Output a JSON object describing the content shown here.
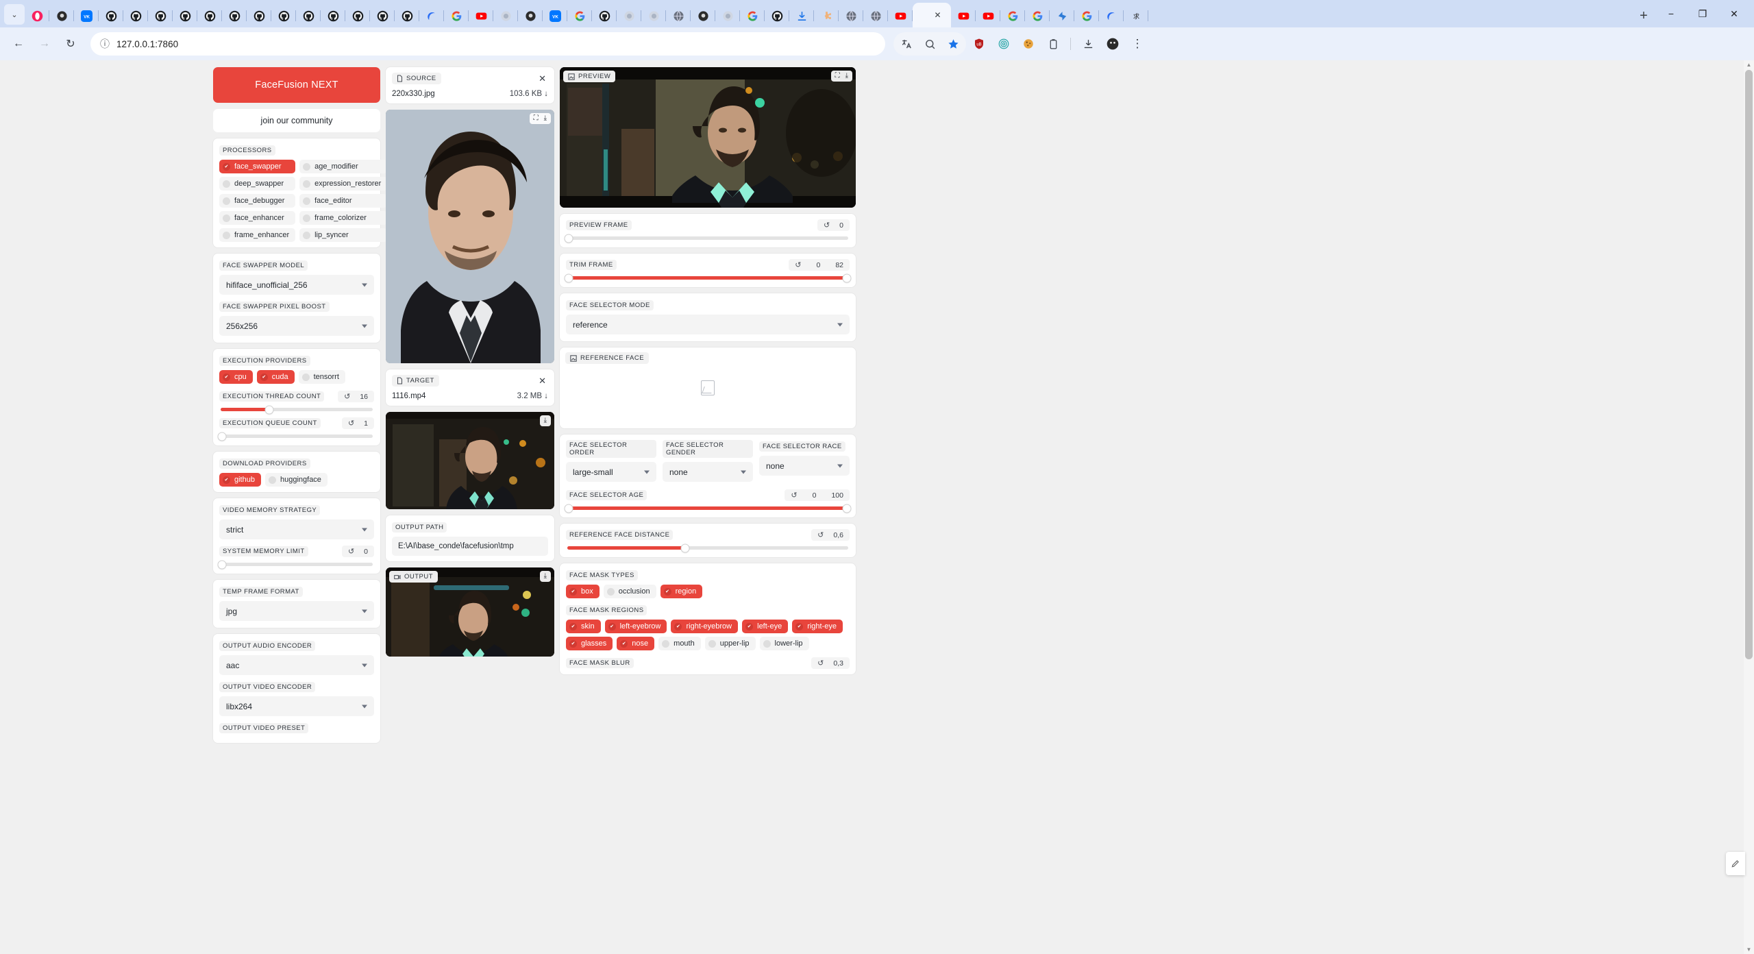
{
  "browser": {
    "url": "127.0.0.1:7860",
    "back_label": "←",
    "forward_label": "→",
    "reload_label": "↻",
    "site_info_label": "ⓘ",
    "new_tab_label": "+",
    "minimize_label": "−",
    "maximize_label": "❐",
    "close_label": "✕",
    "tab_close_label": "✕",
    "menu_label": "⋮",
    "tab_search_label": "⌄",
    "extensions": [
      "translate-icon",
      "zoom-icon",
      "bookmark-star-icon",
      "ublock-icon",
      "fingerprint-icon",
      "cookie-icon",
      "clipboard-icon",
      "download-icon",
      "profile-icon",
      "browser-menu-icon"
    ]
  },
  "app": {
    "brand": "FaceFusion NEXT",
    "community": "join our community",
    "processors": {
      "label": "PROCESSORS",
      "items": [
        {
          "name": "face_swapper",
          "on": true
        },
        {
          "name": "age_modifier",
          "on": false
        },
        {
          "name": "deep_swapper",
          "on": false
        },
        {
          "name": "expression_restorer",
          "on": false
        },
        {
          "name": "face_debugger",
          "on": false
        },
        {
          "name": "face_editor",
          "on": false
        },
        {
          "name": "face_enhancer",
          "on": false
        },
        {
          "name": "frame_colorizer",
          "on": false
        },
        {
          "name": "frame_enhancer",
          "on": false
        },
        {
          "name": "lip_syncer",
          "on": false
        }
      ]
    },
    "face_swapper_model": {
      "label": "FACE SWAPPER MODEL",
      "value": "hififace_unofficial_256"
    },
    "face_swapper_pixel_boost": {
      "label": "FACE SWAPPER PIXEL BOOST",
      "value": "256x256"
    },
    "execution_providers": {
      "label": "EXECUTION PROVIDERS",
      "items": [
        {
          "name": "cpu",
          "on": true
        },
        {
          "name": "cuda",
          "on": true
        },
        {
          "name": "tensorrt",
          "on": false
        }
      ]
    },
    "execution_thread_count": {
      "label": "EXECUTION THREAD COUNT",
      "value": "16",
      "percent": 32,
      "reset": "↺"
    },
    "execution_queue_count": {
      "label": "EXECUTION QUEUE COUNT",
      "value": "1",
      "percent": 0,
      "reset": "↺"
    },
    "download_providers": {
      "label": "DOWNLOAD PROVIDERS",
      "items": [
        {
          "name": "github",
          "on": true
        },
        {
          "name": "huggingface",
          "on": false
        }
      ]
    },
    "video_memory_strategy": {
      "label": "VIDEO MEMORY STRATEGY",
      "value": "strict"
    },
    "system_memory_limit": {
      "label": "SYSTEM MEMORY LIMIT",
      "value": "0",
      "percent": 0,
      "reset": "↺"
    },
    "temp_frame_format": {
      "label": "TEMP FRAME FORMAT",
      "value": "jpg"
    },
    "output_audio_encoder": {
      "label": "OUTPUT AUDIO ENCODER",
      "value": "aac"
    },
    "output_video_encoder": {
      "label": "OUTPUT VIDEO ENCODER",
      "value": "libx264"
    },
    "output_video_preset": {
      "label": "OUTPUT VIDEO PRESET"
    },
    "source": {
      "tag": "SOURCE",
      "filename": "220x330.jpg",
      "size": "103.6 KB",
      "download_glyph": "↓",
      "close_glyph": "✕"
    },
    "target": {
      "tag": "TARGET",
      "filename": "1116.mp4",
      "size": "3.2 MB",
      "download_glyph": "↓",
      "close_glyph": "✕"
    },
    "output_path": {
      "label": "OUTPUT PATH",
      "value": "E:\\AI\\base_conde\\facefusion\\tmp"
    },
    "output": {
      "tag": "OUTPUT"
    },
    "preview": {
      "tag": "PREVIEW"
    },
    "preview_frame": {
      "label": "PREVIEW FRAME",
      "value": "0",
      "percent": 0,
      "reset": "↺"
    },
    "trim_frame": {
      "label": "TRIM FRAME",
      "start": "0",
      "end": "82",
      "start_percent": 0,
      "end_percent": 100,
      "reset": "↺"
    },
    "face_selector_mode": {
      "label": "FACE SELECTOR MODE",
      "value": "reference"
    },
    "reference_face": {
      "tag": "REFERENCE FACE"
    },
    "face_selector_order": {
      "label": "FACE SELECTOR ORDER",
      "value": "large-small"
    },
    "face_selector_gender": {
      "label": "FACE SELECTOR GENDER",
      "value": "none"
    },
    "face_selector_race": {
      "label": "FACE SELECTOR RACE",
      "value": "none"
    },
    "face_selector_age": {
      "label": "FACE SELECTOR AGE",
      "start": "0",
      "end": "100",
      "start_percent": 0,
      "end_percent": 100,
      "reset": "↺"
    },
    "reference_face_distance": {
      "label": "REFERENCE FACE DISTANCE",
      "value": "0,6",
      "percent": 42,
      "reset": "↺"
    },
    "face_mask_types": {
      "label": "FACE MASK TYPES",
      "items": [
        {
          "name": "box",
          "on": true
        },
        {
          "name": "occlusion",
          "on": false
        },
        {
          "name": "region",
          "on": true
        }
      ]
    },
    "face_mask_regions": {
      "label": "FACE MASK REGIONS",
      "items": [
        {
          "name": "skin",
          "on": true
        },
        {
          "name": "left-eyebrow",
          "on": true
        },
        {
          "name": "right-eyebrow",
          "on": true
        },
        {
          "name": "left-eye",
          "on": true
        },
        {
          "name": "right-eye",
          "on": true
        },
        {
          "name": "glasses",
          "on": true
        },
        {
          "name": "nose",
          "on": true
        },
        {
          "name": "mouth",
          "on": false
        },
        {
          "name": "upper-lip",
          "on": false
        },
        {
          "name": "lower-lip",
          "on": false
        }
      ]
    },
    "face_mask_blur": {
      "label": "FACE MASK BLUR",
      "value": "0,3",
      "reset": "↺"
    }
  },
  "colors": {
    "accent": "#e8453c",
    "chip_off": "#f4f4f4",
    "panel": "#ffffff",
    "page_bg": "#f0f0f0"
  }
}
